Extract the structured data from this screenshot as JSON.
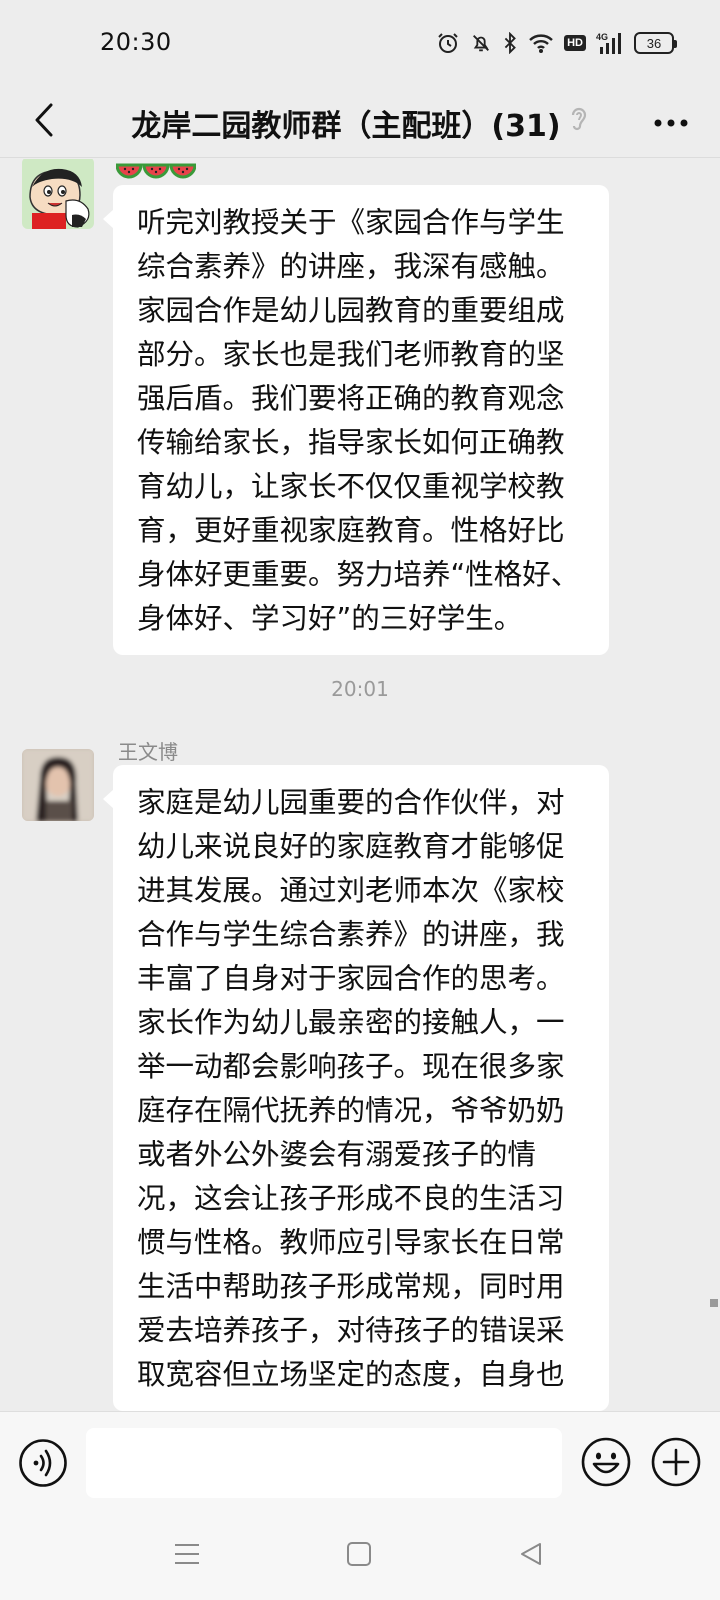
{
  "status_bar": {
    "time": "20:30",
    "battery": "36",
    "hd": "HD",
    "network": "4G"
  },
  "header": {
    "title": "龙岸二园教师群（主配班）(31)",
    "back_icon": "chevron-left-icon",
    "more_icon": "more-horizontal-icon",
    "mode_icon": "ear-icon"
  },
  "messages": [
    {
      "sender": "",
      "avatar": "cartoon-avatar",
      "emoji_prefix": "🍉🍉🍉",
      "text": "听完刘教授关于《家园合作与学生综合素养》的讲座，我深有感触。家园合作是幼儿园教育的重要组成部分。家长也是我们老师教育的坚强后盾。我们要将正确的教育观念传输给家长，指导家长如何正确教育幼儿，让家长不仅仅重视学校教育，更好重视家庭教育。性格好比身体好更重要。努力培养“性格好、身体好、学习好”的三好学生。"
    },
    {
      "sender": "王文博",
      "avatar": "blurred-photo-avatar",
      "text": "家庭是幼儿园重要的合作伙伴，对幼儿来说良好的家庭教育才能够促进其发展。通过刘老师本次《家校合作与学生综合素养》的讲座，我丰富了自身对于家园合作的思考。家长作为幼儿最亲密的接触人，一举一动都会影响孩子。现在很多家庭存在隔代抚养的情况，爷爷奶奶或者外公外婆会有溺爱孩子的情况，这会让孩子形成不良的生活习惯与性格。教师应引导家长在日常生活中帮助孩子形成常规，同时用爱去培养孩子，对待孩子的错误采取宽容但立场坚定的态度，自身也"
    }
  ],
  "time_divider": "20:01",
  "input": {
    "value": "",
    "placeholder": ""
  },
  "colors": {
    "background": "#ededed",
    "bubble": "#ffffff",
    "input_bar": "#f7f7f7"
  }
}
